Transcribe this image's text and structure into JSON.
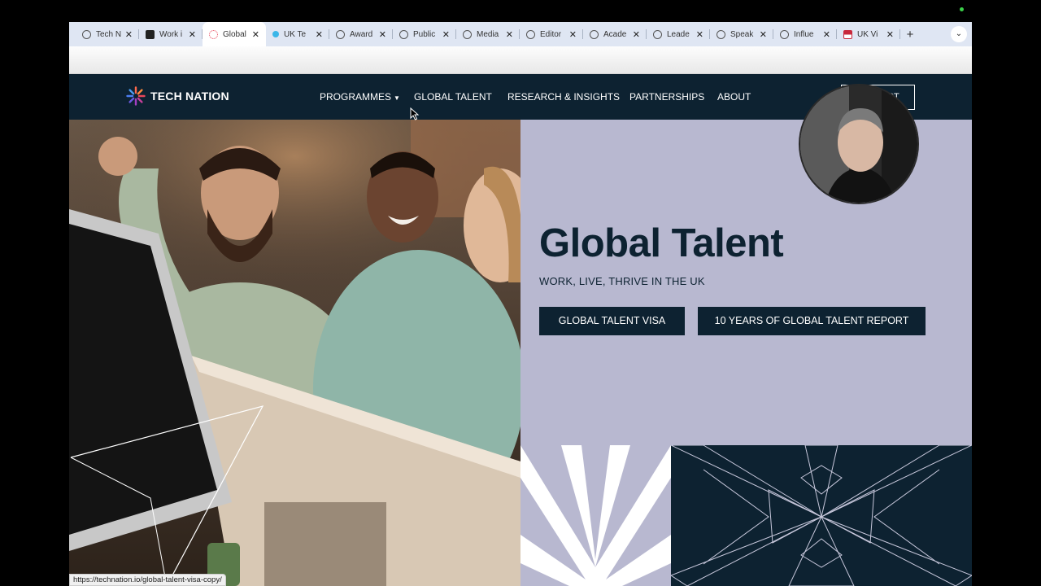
{
  "browser": {
    "tabs": [
      {
        "label": "Tech N",
        "icon": "globe-icon",
        "active": false
      },
      {
        "label": "Work i",
        "icon": "site-icon",
        "active": false
      },
      {
        "label": "Global",
        "icon": "technation-icon",
        "active": true
      },
      {
        "label": "UK Te",
        "icon": "blue-dot-icon",
        "active": false
      },
      {
        "label": "Award",
        "icon": "globe-icon",
        "active": false
      },
      {
        "label": "Public",
        "icon": "globe-icon",
        "active": false
      },
      {
        "label": "Media",
        "icon": "globe-icon",
        "active": false
      },
      {
        "label": "Editor",
        "icon": "globe-icon",
        "active": false
      },
      {
        "label": "Acade",
        "icon": "globe-icon",
        "active": false
      },
      {
        "label": "Leade",
        "icon": "globe-icon",
        "active": false
      },
      {
        "label": "Speak",
        "icon": "globe-icon",
        "active": false
      },
      {
        "label": "Influe",
        "icon": "globe-icon",
        "active": false
      },
      {
        "label": "UK Vi",
        "icon": "flag-icon",
        "active": false
      }
    ],
    "close_glyph": "✕",
    "new_tab_glyph": "+",
    "tab_list_glyph": "⌄",
    "status_url": "https://technation.io/global-talent-visa-copy/"
  },
  "site": {
    "logo_text": "TECH NATION",
    "nav": {
      "programmes": "PROGRAMMES",
      "global_talent": "GLOBAL TALENT",
      "research": "RESEARCH & INSIGHTS",
      "partnerships": "PARTNERSHIPS",
      "about": "ABOUT"
    },
    "cta_label": "CONTACT",
    "hero": {
      "title": "Global Talent",
      "subtitle": "WORK, LIVE, THRIVE IN THE UK",
      "button_visa": "GLOBAL TALENT VISA",
      "button_report": "10 YEARS OF GLOBAL TALENT REPORT"
    }
  },
  "colors": {
    "navy": "#0d2231",
    "lavender": "#b8b8d0",
    "logo_accent": "#e8475a"
  }
}
